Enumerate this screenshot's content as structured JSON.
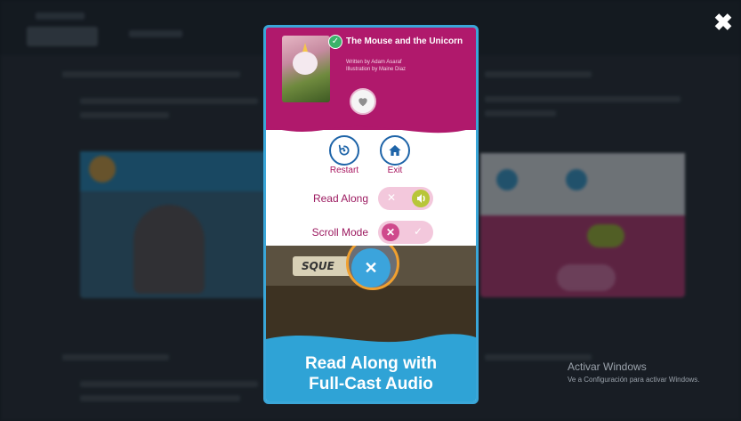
{
  "modal": {
    "book_title": "The Mouse and the Unicorn",
    "written_by": "Written by Adam Asaraf",
    "illustration_by": "Illustration by Maine Diaz",
    "restart_label": "Restart",
    "exit_label": "Exit",
    "read_along_label": "Read Along",
    "scroll_mode_label": "Scroll Mode",
    "read_along_on": true,
    "scroll_mode_on": false,
    "scene_sign_text": "SQUE",
    "banner_line1": "Read Along with",
    "banner_line2": "Full-Cast Audio"
  },
  "icons": {
    "close": "close-icon",
    "check": "check-icon",
    "heart": "heart-icon",
    "restart": "restart-icon",
    "home": "home-icon",
    "sound": "sound-icon",
    "mute": "mute-icon",
    "x": "x-icon"
  },
  "windows_watermark": {
    "title": "Activar Windows",
    "subtitle": "Ve a Configuración para activar Windows."
  },
  "colors": {
    "brand_magenta": "#b0196c",
    "accent_blue": "#1e64a8",
    "banner_blue": "#2fa3d6",
    "toggle_on": "#b8c638",
    "toggle_off": "#cf4a8c"
  }
}
